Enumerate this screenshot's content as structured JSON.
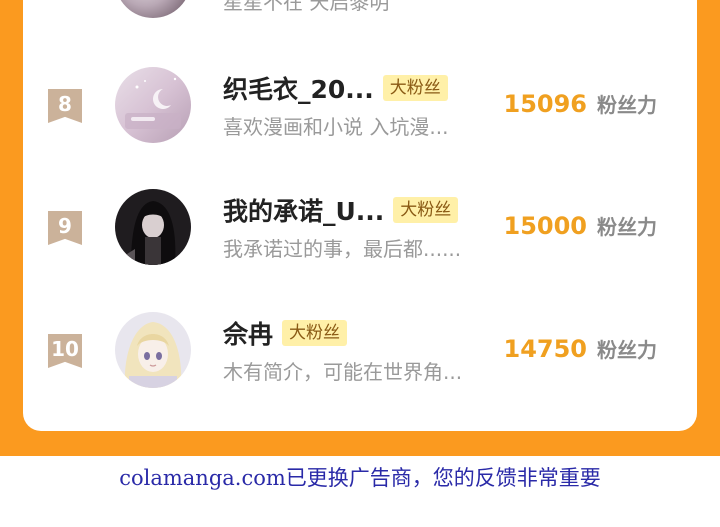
{
  "previous_row": {
    "bio": "星星不在 天启黎明"
  },
  "fans": [
    {
      "rank": "8",
      "name": "织毛衣_20...",
      "badge": "大粉丝",
      "bio": "喜欢漫画和小说 入坑漫...",
      "score": "15096",
      "score_unit": "粉丝力",
      "avatar_icon": "avatar-pink-moon"
    },
    {
      "rank": "9",
      "name": "我的承诺_U...",
      "badge": "大粉丝",
      "bio": "我承诺过的事，最后都......",
      "score": "15000",
      "score_unit": "粉丝力",
      "avatar_icon": "avatar-dark-hair-girl"
    },
    {
      "rank": "10",
      "name": "佘冉",
      "badge": "大粉丝",
      "bio": "木有简介，可能在世界角...",
      "score": "14750",
      "score_unit": "粉丝力",
      "avatar_icon": "avatar-anime-blonde-girl"
    }
  ],
  "footer": {
    "notice": "colamanga.com已更换广告商，您的反馈非常重要"
  },
  "colors": {
    "frame": "#fb9a1f",
    "score": "#f0a020",
    "badge_bg": "#fff0a8",
    "rank_badge": "#cbb29a",
    "footer_text": "#2a2aa8"
  }
}
